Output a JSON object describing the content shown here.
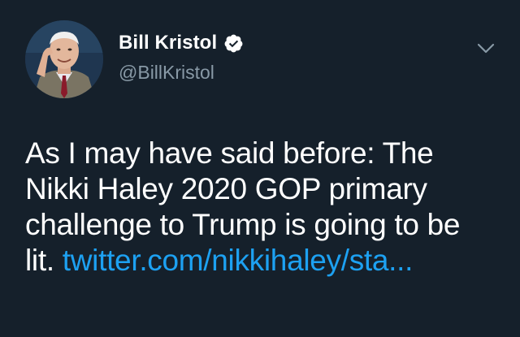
{
  "author": {
    "display_name": "Bill Kristol",
    "handle": "@BillKristol",
    "verified": true,
    "avatar_icon": "profile-photo"
  },
  "tweet": {
    "line1": "As I may have said before: The",
    "line2": "Nikki Haley 2020 GOP primary",
    "line3": "challenge to Trump is going to be",
    "line4_text": "lit. ",
    "link_text": "twitter.com/nikkihaley/sta..."
  },
  "icons": {
    "more": "chevron-down-icon",
    "verified": "verified-badge-icon"
  },
  "colors": {
    "background": "#15202b",
    "text": "#ffffff",
    "secondary_text": "#8899a6",
    "link": "#1da1f2"
  }
}
